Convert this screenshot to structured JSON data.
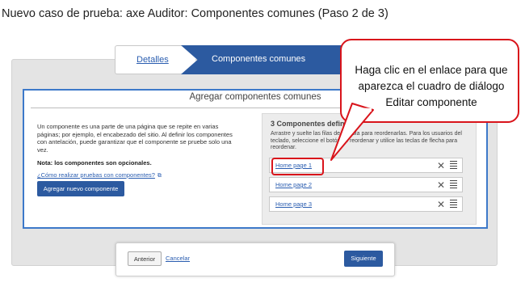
{
  "page_title": "Nuevo caso de prueba: axe Auditor: Componentes comunes (Paso 2 de 3)",
  "wizard": {
    "steps": [
      {
        "label": "Detalles",
        "state": "link"
      },
      {
        "label": "Componentes comunes",
        "state": "active"
      }
    ]
  },
  "panel": {
    "title": "Agregar componentes comunes",
    "description": "Un componente es una parte de una página que se repite en varias páginas; por ejemplo, el encabezado del sitio. Al definir los componentes con antelación, puede garantizar que el componente se pruebe solo una vez.",
    "note": "Nota: los componentes son opcionales.",
    "howto_link": "¿Cómo realizar pruebas con componentes?",
    "howto_icon": "external-link-icon",
    "add_button": "Agregar nuevo componente",
    "list": {
      "heading": "3 Componentes definidos",
      "instructions": "Arrastre y suelte las filas de la tabla para reordenarlas. Para los usuarios del teclado, seleccione el botón de reordenar y utilice las teclas de flecha para reordenar.",
      "rows": [
        {
          "label": "Home page 1",
          "delete_icon": "close-icon",
          "drag_icon": "drag-handle-icon"
        },
        {
          "label": "Home page 2",
          "delete_icon": "close-icon",
          "drag_icon": "drag-handle-icon"
        },
        {
          "label": "Home page 3",
          "delete_icon": "close-icon",
          "drag_icon": "drag-handle-icon"
        }
      ]
    }
  },
  "callout": {
    "text": "Haga clic en el enlace para que aparezca el cuadro de diálogo Editar componente",
    "border_color": "#d9141b"
  },
  "footer": {
    "prev_button": "Anterior",
    "cancel_link": "Cancelar",
    "next_button": "Siguiente"
  },
  "colors": {
    "accent": "#2c5aa0",
    "link": "#2a5db0",
    "highlight": "#d9141b"
  }
}
